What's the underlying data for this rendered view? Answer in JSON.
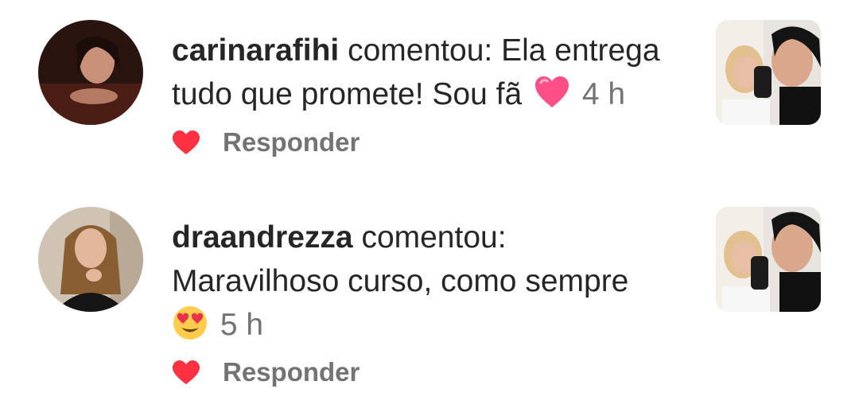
{
  "comments": [
    {
      "username": "carinarafihi",
      "verb": "comentou:",
      "text_line1": "Ela entrega",
      "text_line2": "tudo que promete! Sou fã",
      "emoji": "pink-heart",
      "time": "4 h",
      "reply_label": "Responder",
      "liked": true
    },
    {
      "username": "draandrezza",
      "verb": "comentou:",
      "text_line1": "Maravilhoso curso, como sempre",
      "emoji": "heart-eyes",
      "time": "5 h",
      "reply_label": "Responder",
      "liked": true
    }
  ],
  "colors": {
    "like_red": "#ff3040",
    "secondary_text": "#737373",
    "primary_text": "#262626"
  }
}
